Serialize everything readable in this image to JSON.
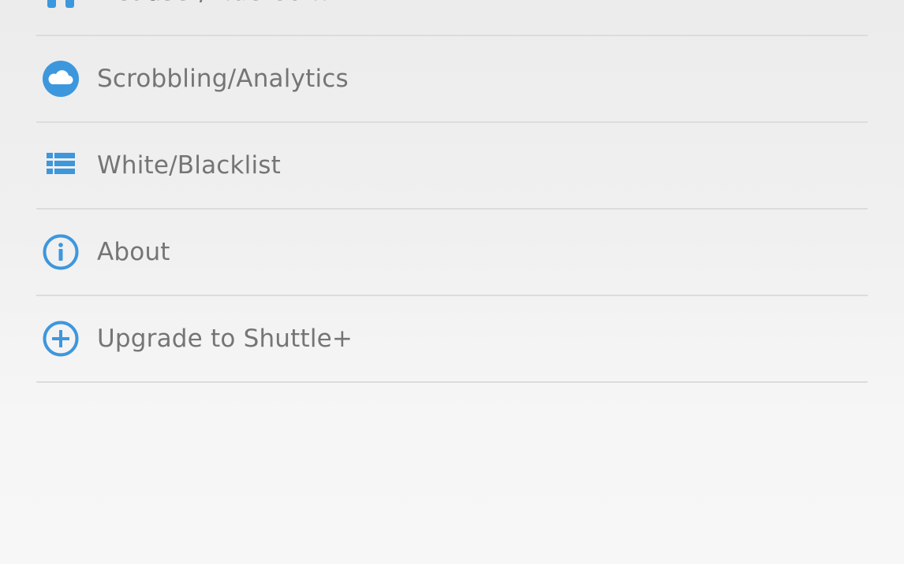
{
  "accent_color": "#3d97dd",
  "settings": {
    "items": [
      {
        "label": "Headset/Bluetooth",
        "icon": "headset-icon"
      },
      {
        "label": "Scrobbling/Analytics",
        "icon": "cloud-icon"
      },
      {
        "label": "White/Blacklist",
        "icon": "list-icon"
      },
      {
        "label": "About",
        "icon": "info-icon"
      },
      {
        "label": "Upgrade to Shuttle+",
        "icon": "add-circle-icon"
      }
    ]
  }
}
